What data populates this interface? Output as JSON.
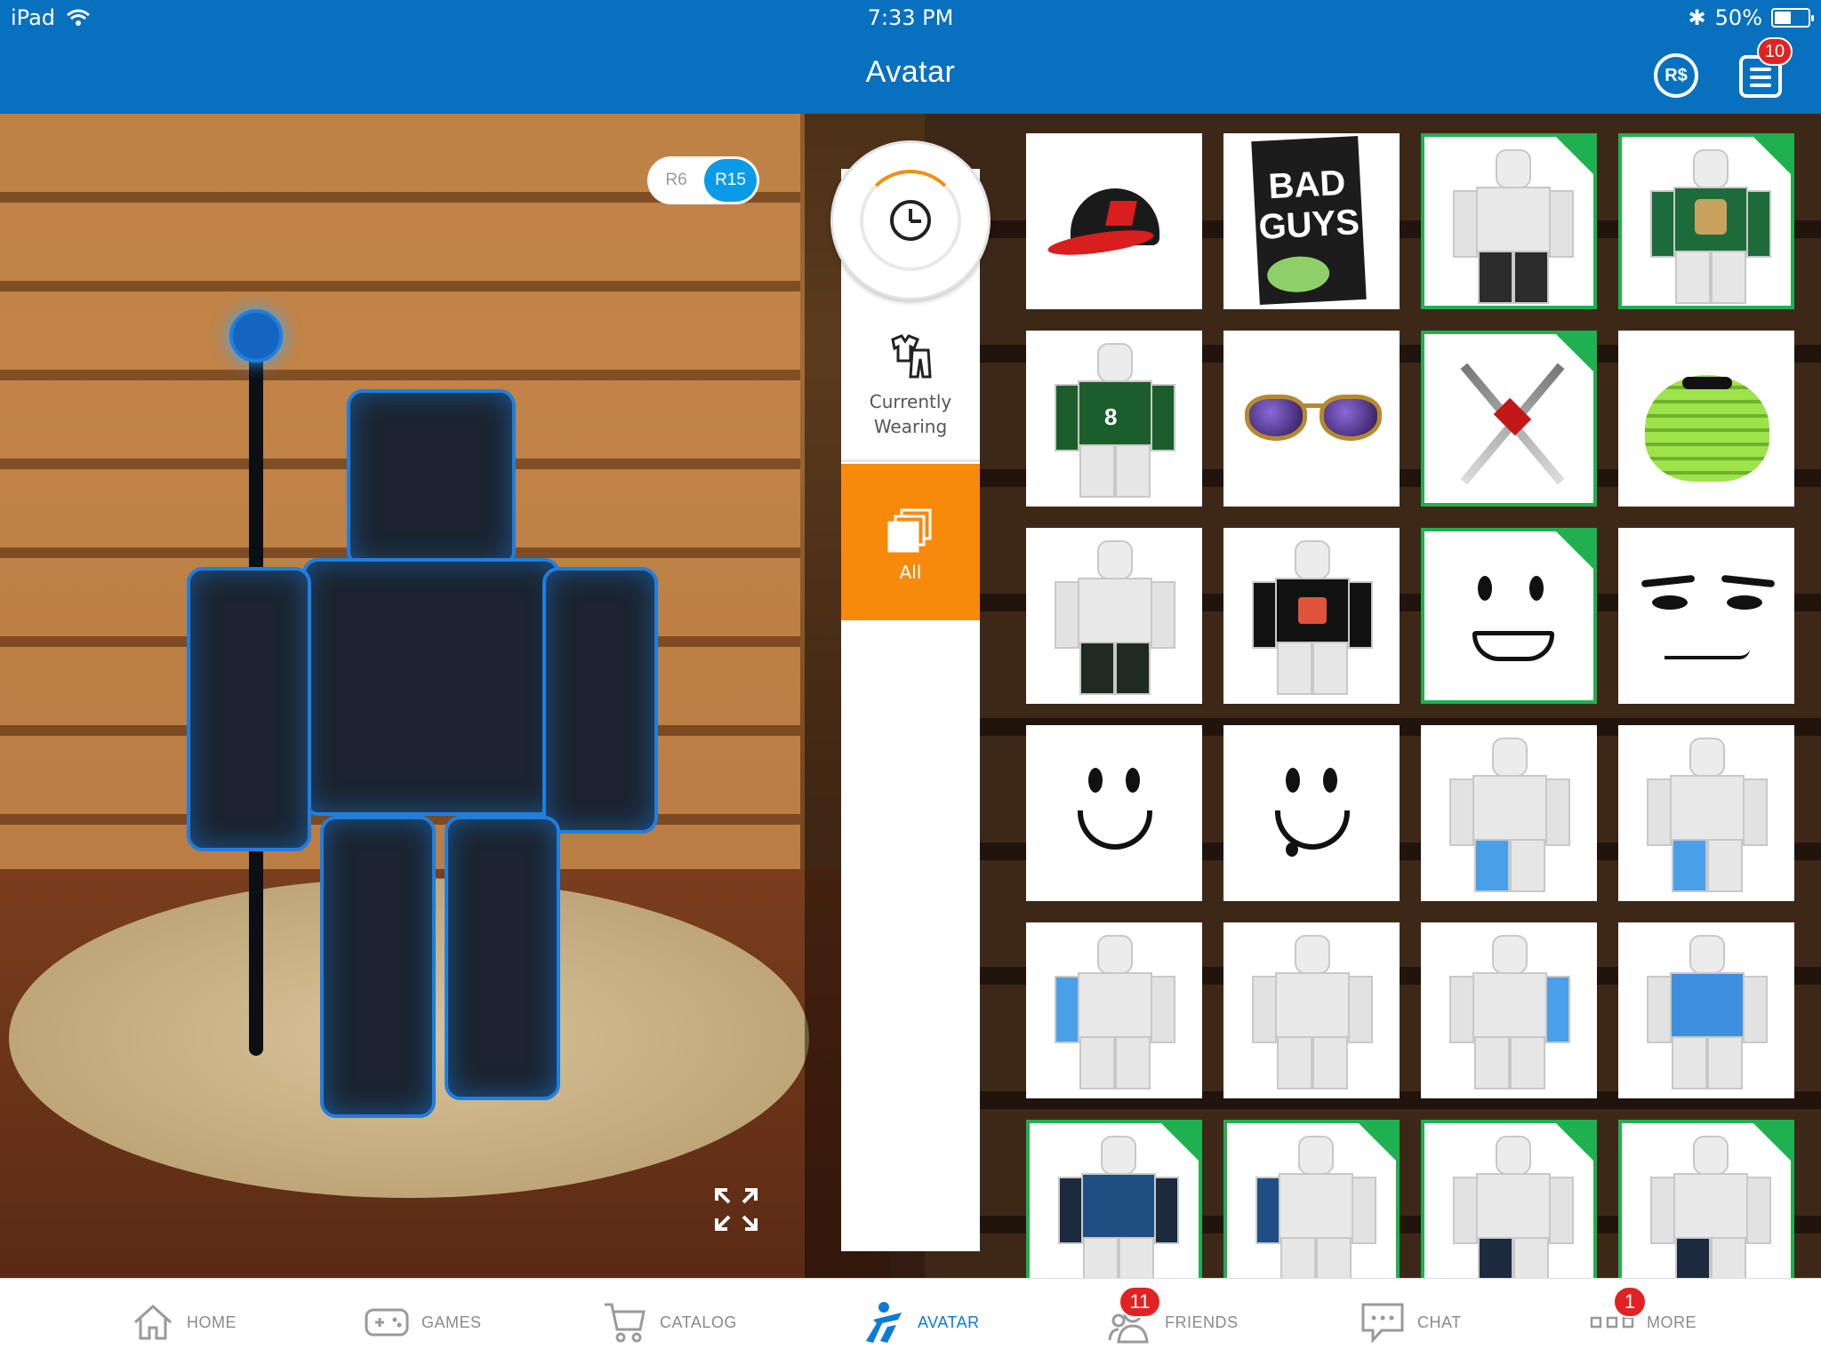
{
  "status_bar": {
    "device": "iPad",
    "time": "7:33 PM",
    "battery": "50%",
    "battery_level": 0.5
  },
  "header": {
    "title": "Avatar",
    "robux_label": "R$",
    "notifications_count": "10"
  },
  "rig_toggle": {
    "options": [
      "R6",
      "R15"
    ],
    "selected": "R15"
  },
  "categories": {
    "recent_icon": "clock-icon",
    "currently_wearing": "Currently Wearing",
    "all": "All",
    "selected": "All"
  },
  "items": [
    {
      "kind": "hat",
      "equipped": false
    },
    {
      "kind": "book",
      "title_top": "BAD",
      "title_bottom": "GUYS",
      "equipped": false
    },
    {
      "kind": "pants",
      "equipped": true
    },
    {
      "kind": "shirt-green",
      "equipped": true
    },
    {
      "kind": "jersey",
      "number": "8",
      "equipped": false
    },
    {
      "kind": "sunglasses",
      "equipped": false
    },
    {
      "kind": "swords",
      "equipped": true
    },
    {
      "kind": "slime",
      "equipped": false
    },
    {
      "kind": "pants-dark",
      "equipped": false
    },
    {
      "kind": "shirt-black",
      "equipped": false
    },
    {
      "kind": "face-sparkle",
      "equipped": true
    },
    {
      "kind": "face-smirk",
      "equipped": false
    },
    {
      "kind": "face-smile",
      "equipped": false
    },
    {
      "kind": "face-drool",
      "equipped": false
    },
    {
      "kind": "char-leg",
      "equipped": false
    },
    {
      "kind": "char-leg",
      "equipped": false
    },
    {
      "kind": "char-arm",
      "equipped": false
    },
    {
      "kind": "char-plain",
      "equipped": false
    },
    {
      "kind": "char-arm-r",
      "equipped": false
    },
    {
      "kind": "char-torso",
      "equipped": false
    },
    {
      "kind": "char-armor",
      "equipped": true
    },
    {
      "kind": "char-armor-arm",
      "equipped": true
    },
    {
      "kind": "char-leg-dark",
      "equipped": true
    },
    {
      "kind": "char-leg-dark",
      "equipped": true
    }
  ],
  "bottom_nav": [
    {
      "label": "HOME",
      "icon": "home-icon",
      "badge": ""
    },
    {
      "label": "GAMES",
      "icon": "gamepad-icon",
      "badge": ""
    },
    {
      "label": "CATALOG",
      "icon": "cart-icon",
      "badge": ""
    },
    {
      "label": "AVATAR",
      "icon": "avatar-icon",
      "badge": "",
      "active": true
    },
    {
      "label": "FRIENDS",
      "icon": "friends-icon",
      "badge": "11"
    },
    {
      "label": "CHAT",
      "icon": "chat-icon",
      "badge": ""
    },
    {
      "label": "MORE",
      "icon": "more-icon",
      "badge": "1"
    }
  ],
  "colors": {
    "header_blue": "#0770bf",
    "active_tab_orange": "#f7890b",
    "equipped_green": "#1fb050",
    "nav_active_blue": "#0a7cd6",
    "badge_red": "#e22222"
  }
}
